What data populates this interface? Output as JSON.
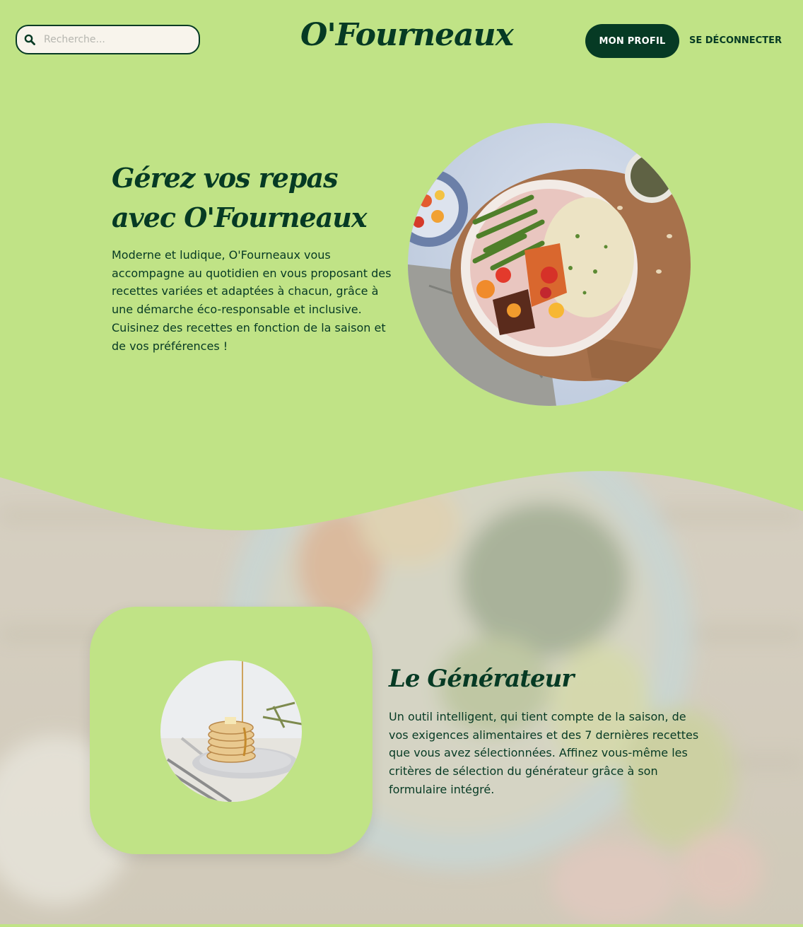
{
  "header": {
    "search_placeholder": "Recherche...",
    "logo": "O'Fourneaux",
    "profile_button": "MON PROFIL",
    "logout_link": "SE DÉCONNECTER"
  },
  "hero": {
    "title": "Gérez vos repas avec O'Fourneaux",
    "text": "Moderne et ludique, O'Fourneaux vous accompagne au quotidien en vous proposant des recettes variées et adaptées à chacun, grâce à une démarche éco-responsable et inclusive. Cuisinez des recettes en fonction de la saison et de vos préférences !",
    "image_icon": "food-bowl-photo"
  },
  "generator": {
    "title": "Le Générateur",
    "text": "Un outil intelligent, qui tient compte de la saison, de vos exigences alimentaires et des 7 dernières recettes que vous avez sélectionnées. Affinez vous-même les critères de sélection du générateur grâce à son formulaire intégré.",
    "image_icon": "pancakes-photo"
  },
  "colors": {
    "background_green": "#c0e386",
    "dark_green": "#063a24",
    "search_bg": "#f8f4ec"
  }
}
